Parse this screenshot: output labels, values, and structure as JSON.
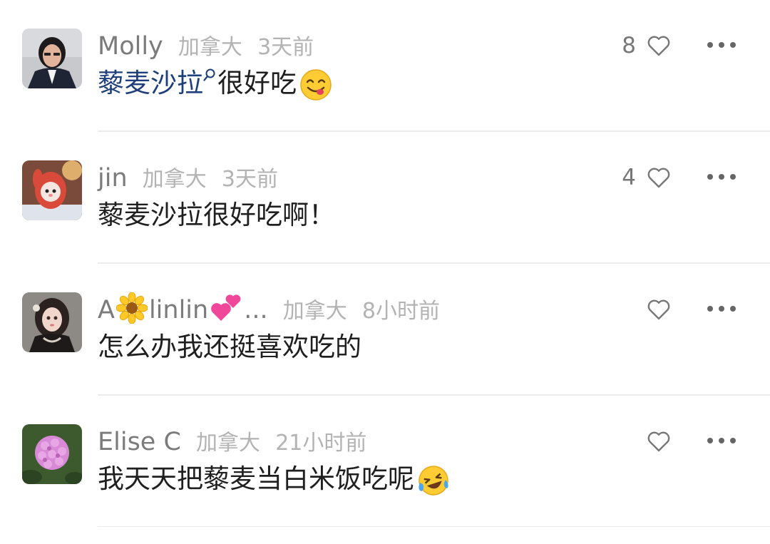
{
  "comments": [
    {
      "username": "Molly",
      "region": "加拿大",
      "time": "3天前",
      "keyword": "藜麦沙拉",
      "text": "很好吃",
      "likes": "8",
      "emoji": "yum-face-emoji",
      "avatar": "woman-portrait"
    },
    {
      "username": "jin",
      "region": "加拿大",
      "time": "3天前",
      "text": "藜麦沙拉很好吃啊！",
      "likes": "4",
      "avatar": "bunny-in-red-hood"
    },
    {
      "username_prefix": "A",
      "username_mid": "linlin",
      "username_suffix": "...",
      "username_emojis": [
        "sunflower-emoji",
        "two-hearts-emoji"
      ],
      "region": "加拿大",
      "time": "8小时前",
      "text": "怎么办我还挺喜欢吃的",
      "likes": "",
      "avatar": "doll-girl"
    },
    {
      "username": "Elise C",
      "region": "加拿大",
      "time": "21小时前",
      "text": "我天天把藜麦当白米饭吃呢",
      "likes": "",
      "emoji": "crying-laughing-emoji",
      "avatar": "hydrangea-flower"
    }
  ],
  "colors": {
    "username": "#7b7b7b",
    "meta": "#b3b3b3",
    "body": "#1f1f1f",
    "keyword": "#1e3f7a",
    "icons": "#777777",
    "divider": "#ececec"
  }
}
